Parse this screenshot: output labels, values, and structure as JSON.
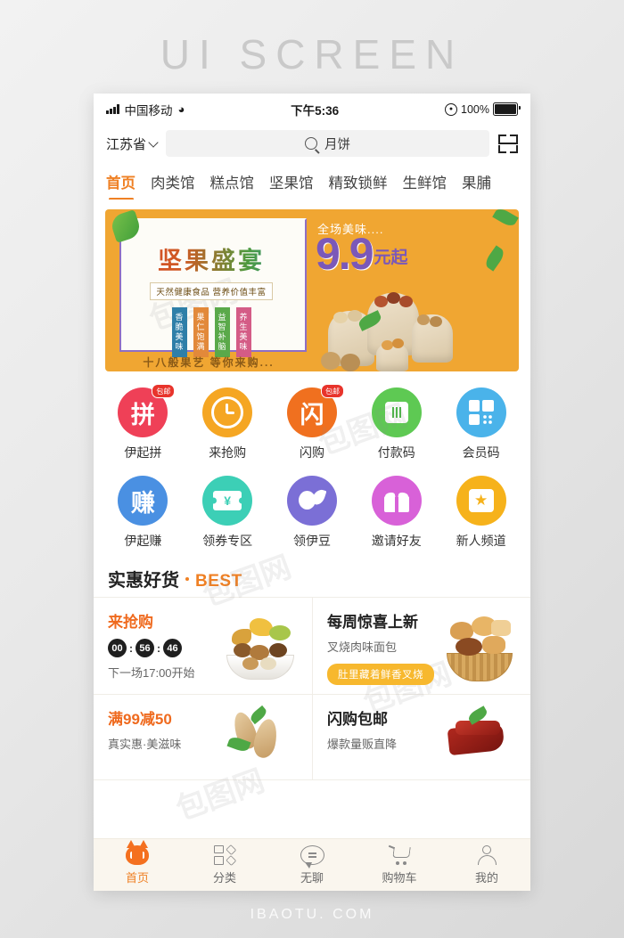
{
  "page": {
    "title": "UI SCREEN",
    "footer": "IBAOTU. COM"
  },
  "colors": {
    "accent": "#ef8024",
    "banner_bg": "#f0a632",
    "tabbar_bg": "#faf6ee",
    "price_purple": "#7b58b8"
  },
  "status_bar": {
    "carrier": "中国移动",
    "time": "下午5:36",
    "battery_percent": "100%",
    "signal_icon": "signal-bars-icon",
    "wifi_icon": "wifi-icon",
    "lock_icon": "rotation-lock-icon",
    "battery_icon": "battery-icon"
  },
  "search": {
    "location": "江苏省",
    "location_chevron": "chevron-down-icon",
    "search_icon": "search-icon",
    "value": "月饼",
    "placeholder": "月饼",
    "scan_icon": "scan-icon"
  },
  "category_tabs": [
    {
      "label": "首页",
      "active": true
    },
    {
      "label": "肉类馆",
      "active": false
    },
    {
      "label": "糕点馆",
      "active": false
    },
    {
      "label": "坚果馆",
      "active": false
    },
    {
      "label": "精致锁鲜",
      "active": false
    },
    {
      "label": "生鲜馆",
      "active": false
    },
    {
      "label": "果脯",
      "active": false
    }
  ],
  "banner": {
    "title": "坚果盛宴",
    "subtitle": "天然健康食品 营养价值丰富",
    "tags": [
      "香脆美味",
      "果仁饱满",
      "益智补脑",
      "养生美味"
    ],
    "footer_text": "十八般果艺 等你来购...",
    "promo_hint": "全场美味....",
    "price_number": "9.9",
    "price_unit": "元起"
  },
  "quick_grid": [
    {
      "label": "伊起拼",
      "glyph": "拼",
      "badge": "包邮",
      "icon": "pin-group-buy-icon",
      "bg": "#ef4057"
    },
    {
      "label": "来抢购",
      "glyph": "",
      "badge": "",
      "icon": "clock-icon",
      "bg": "#f5a623"
    },
    {
      "label": "闪购",
      "glyph": "闪",
      "badge": "包邮",
      "icon": "flash-sale-icon",
      "bg": "#f0701f"
    },
    {
      "label": "付款码",
      "glyph": "",
      "badge": "",
      "icon": "barcode-icon",
      "bg": "#5ec953"
    },
    {
      "label": "会员码",
      "glyph": "",
      "badge": "",
      "icon": "qrcode-icon",
      "bg": "#4ab3ea"
    },
    {
      "label": "伊起赚",
      "glyph": "赚",
      "badge": "",
      "icon": "earn-icon",
      "bg": "#4a90e2"
    },
    {
      "label": "领券专区",
      "glyph": "",
      "badge": "",
      "icon": "coupon-ticket-icon",
      "bg": "#3ccfb6"
    },
    {
      "label": "领伊豆",
      "glyph": "",
      "badge": "",
      "icon": "bean-icon",
      "bg": "#7b6fd6"
    },
    {
      "label": "邀请好友",
      "glyph": "",
      "badge": "",
      "icon": "gift-icon",
      "bg": "#d861d8"
    },
    {
      "label": "新人频道",
      "glyph": "",
      "badge": "",
      "icon": "star-badge-icon",
      "bg": "#f6b21b"
    }
  ],
  "section": {
    "title": "实惠好货",
    "best": "BEST"
  },
  "products": [
    {
      "title": "来抢购",
      "title_orange": true,
      "countdown": {
        "hours": "00",
        "minutes": "56",
        "seconds": "46",
        "separator": ":"
      },
      "subtitle": "下一场17:00开始",
      "pill": "",
      "image": "mixed-nuts-bowl-image"
    },
    {
      "title": "每周惊喜上新",
      "title_orange": false,
      "countdown": null,
      "subtitle": "叉烧肉味面包",
      "pill": "肚里藏着鲜香叉烧",
      "image": "bread-basket-image"
    },
    {
      "title": "满99减50",
      "title_orange": true,
      "countdown": null,
      "subtitle": "真实惠·美滋味",
      "pill": "",
      "image": "almond-image"
    },
    {
      "title": "闪购包邮",
      "title_orange": false,
      "countdown": null,
      "subtitle": "爆款量贩直降",
      "pill": "",
      "image": "dried-meat-image"
    }
  ],
  "tab_bar": [
    {
      "label": "首页",
      "icon": "cat-home-icon",
      "active": true
    },
    {
      "label": "分类",
      "icon": "grid-category-icon",
      "active": false
    },
    {
      "label": "无聊",
      "icon": "chat-icon",
      "active": false
    },
    {
      "label": "购物车",
      "icon": "shopping-cart-icon",
      "active": false
    },
    {
      "label": "我的",
      "icon": "person-icon",
      "active": false
    }
  ]
}
